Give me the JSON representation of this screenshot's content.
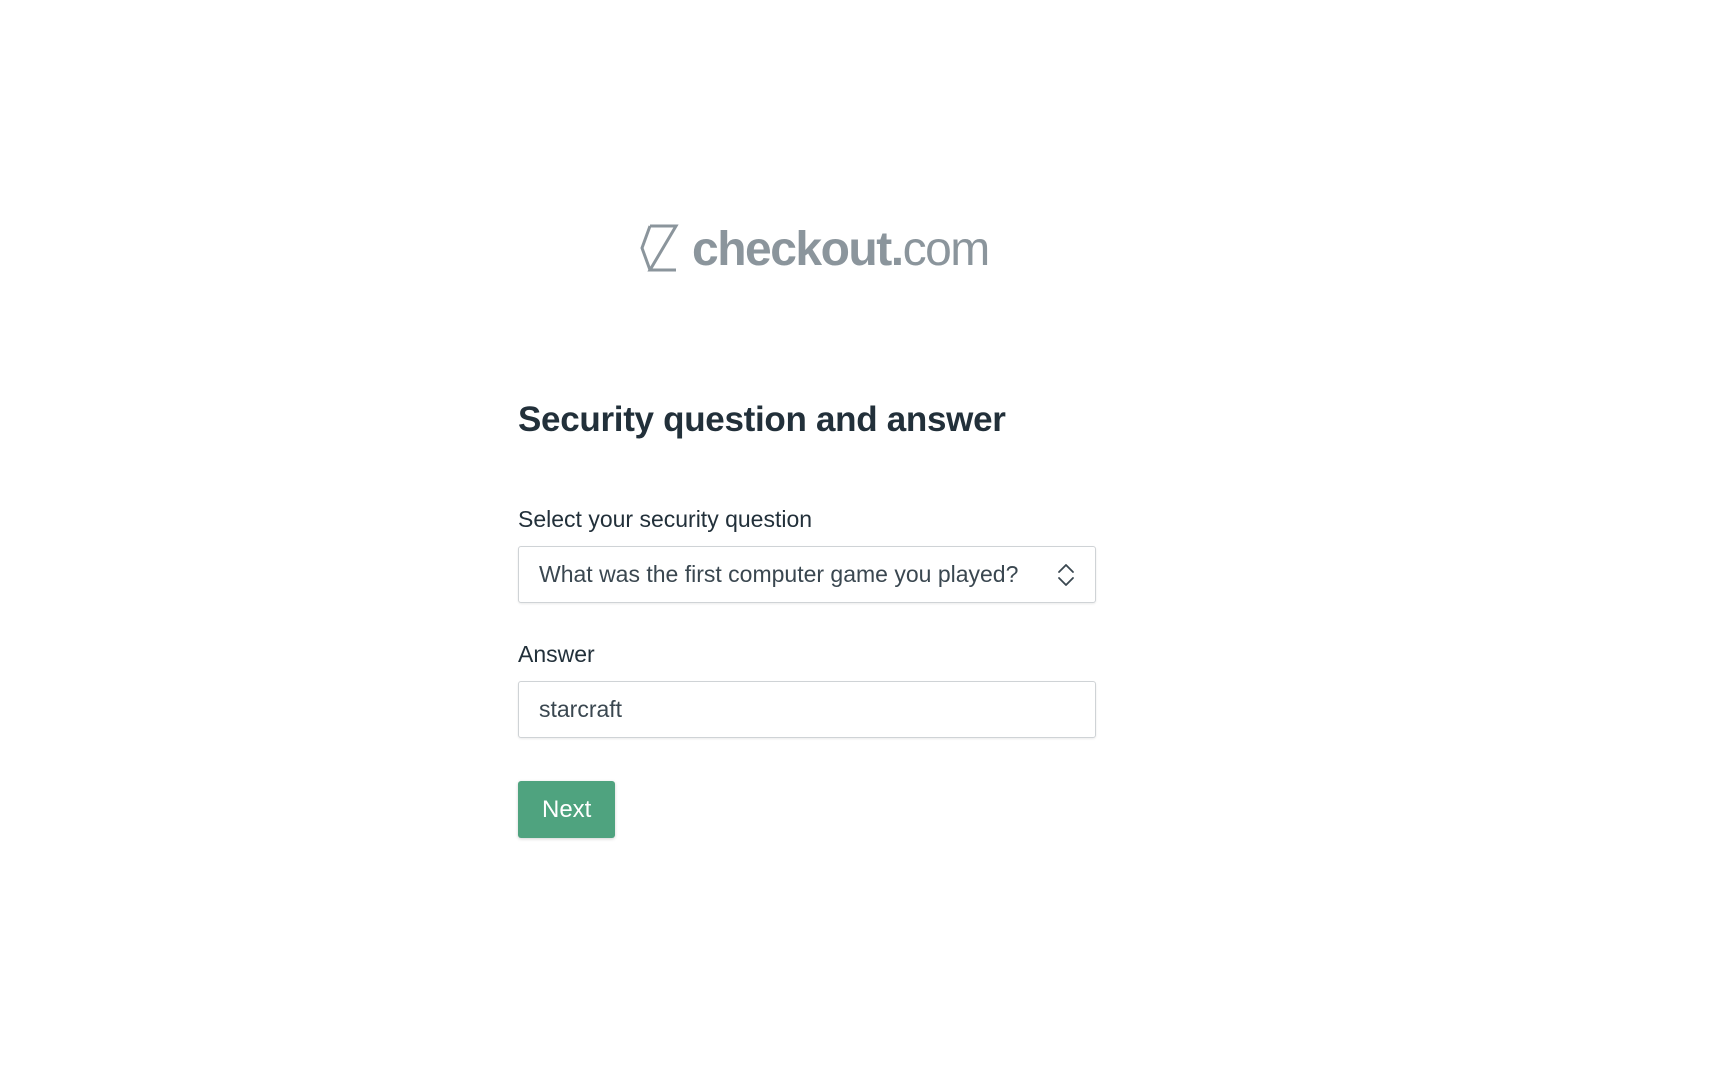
{
  "logo": {
    "bold_text": "checkout.",
    "light_text": "com",
    "icon": "checkout-hourglass-logo-icon",
    "color": "#8b959c"
  },
  "form": {
    "title": "Security question and answer",
    "question_label": "Select your security question",
    "question_value": "What was the first computer game you played?",
    "question_icon": "chevron-up-down-icon",
    "answer_label": "Answer",
    "answer_value": "starcraft",
    "next_label": "Next"
  },
  "colors": {
    "accent": "#4fa37f",
    "text": "#22303a",
    "border": "#cfd3d6"
  }
}
